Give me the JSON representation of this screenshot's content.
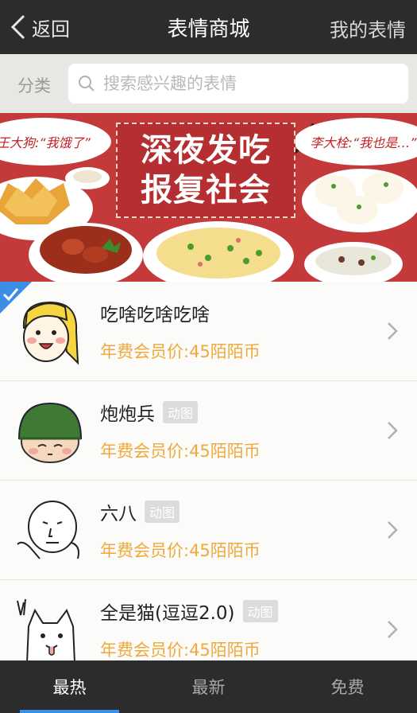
{
  "nav": {
    "back_label": "返回",
    "title": "表情商城",
    "right_label": "我的表情"
  },
  "search": {
    "category_label": "分类",
    "placeholder": "搜索感兴趣的表情"
  },
  "banner": {
    "title_line1": "深夜发吃",
    "title_line2": "报复社会",
    "bubble_left": "王大狗:“我饿了”",
    "bubble_right": "李大栓:“我也是…”"
  },
  "items": [
    {
      "name": "吃啥吃啥吃啥",
      "tag": "",
      "price": "年费会员价:45陌陌币",
      "selected": true,
      "avatar": "blonde-girl-face"
    },
    {
      "name": "炮炮兵",
      "tag": "动图",
      "price": "年费会员价:45陌陌币",
      "selected": false,
      "avatar": "helmet-soldier-face"
    },
    {
      "name": "六八",
      "tag": "动图",
      "price": "年费会员价:45陌陌币",
      "selected": false,
      "avatar": "sketch-man-face"
    },
    {
      "name": "全是猫(逗逗2.0)",
      "tag": "动图",
      "price": "年费会员价:45陌陌币",
      "selected": false,
      "avatar": "sketch-cat-face"
    }
  ],
  "tabs": [
    {
      "label": "最热",
      "active": true
    },
    {
      "label": "最新",
      "active": false
    },
    {
      "label": "免费",
      "active": false
    }
  ],
  "colors": {
    "nav_bg": "#2c2c2c",
    "price": "#f0a93b",
    "accent": "#3a8ee6",
    "banner_red": "#c4393a"
  }
}
